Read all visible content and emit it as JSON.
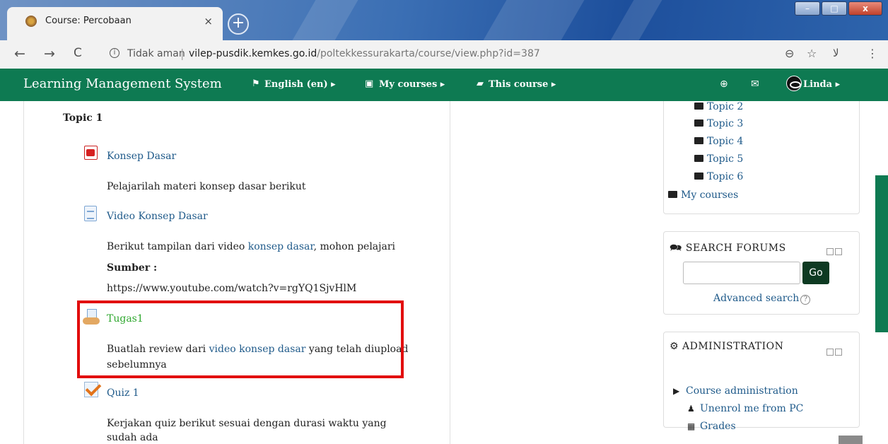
{
  "browser": {
    "tab_title": "Course: Percobaan",
    "tab_close": "×",
    "new_tab": "+",
    "security_label": "Tidak aman",
    "url_host": "vilep-pusdik.kemkes.go.id",
    "url_path": "/poltekkessurakarta/course/view.php?id=387",
    "window_minimize": "–",
    "window_maximize": "□",
    "window_close": "x",
    "nav_back": "←",
    "nav_forward": "→",
    "nav_reload": "C",
    "zoom_icon": "⊖",
    "star_icon": "☆",
    "menu_icon": "⋮",
    "extension_icon": "ﻻ"
  },
  "navbar": {
    "brand": "Learning Management System",
    "language": "English (en) ▸",
    "my_courses": "My courses ▸",
    "this_course": "This course ▸",
    "user": "Linda ▸"
  },
  "content": {
    "topic_title": "Topic 1",
    "activities": [
      {
        "title": "Konsep Dasar",
        "icon": "pdf-icon",
        "description": "Pelajarilah materi konsep dasar berikut"
      },
      {
        "title": "Video Konsep Dasar",
        "icon": "page-icon",
        "description_pre": "Berikut tampilan dari video ",
        "description_link": "konsep dasar",
        "description_post": ", mohon pelajari",
        "source_label": "Sumber :",
        "source_url": "https://www.youtube.com/watch?v=rgYQ1SjvHlM"
      },
      {
        "title": "Tugas1",
        "icon": "assignment-icon",
        "description_pre": "Buatlah review dari ",
        "description_link": "video konsep dasar",
        "description_post": " yang telah diupload",
        "description_line2": "sebelumnya"
      },
      {
        "title": "Quiz 1",
        "icon": "quiz-icon",
        "description_line1": "Kerjakan quiz berikut sesuai dengan durasi waktu yang",
        "description_line2": "sudah ada"
      }
    ],
    "highlight_color": "#e20d0d"
  },
  "navigation_block": {
    "items": [
      "Topic 2",
      "Topic 3",
      "Topic 4",
      "Topic 5",
      "Topic 6"
    ],
    "my_courses": "My courses"
  },
  "search_block": {
    "heading": "SEARCH FORUMS",
    "input_value": "",
    "go_label": "Go",
    "advanced_label": "Advanced search",
    "help": "?"
  },
  "admin_block": {
    "heading": "ADMINISTRATION",
    "course_admin": "Course administration",
    "unenrol": "Unenrol me from PC",
    "grades": "Grades"
  },
  "colors": {
    "navbar_bg": "#0e7a52",
    "link": "#1f5a8a",
    "assignment_link": "#2fa82f"
  }
}
